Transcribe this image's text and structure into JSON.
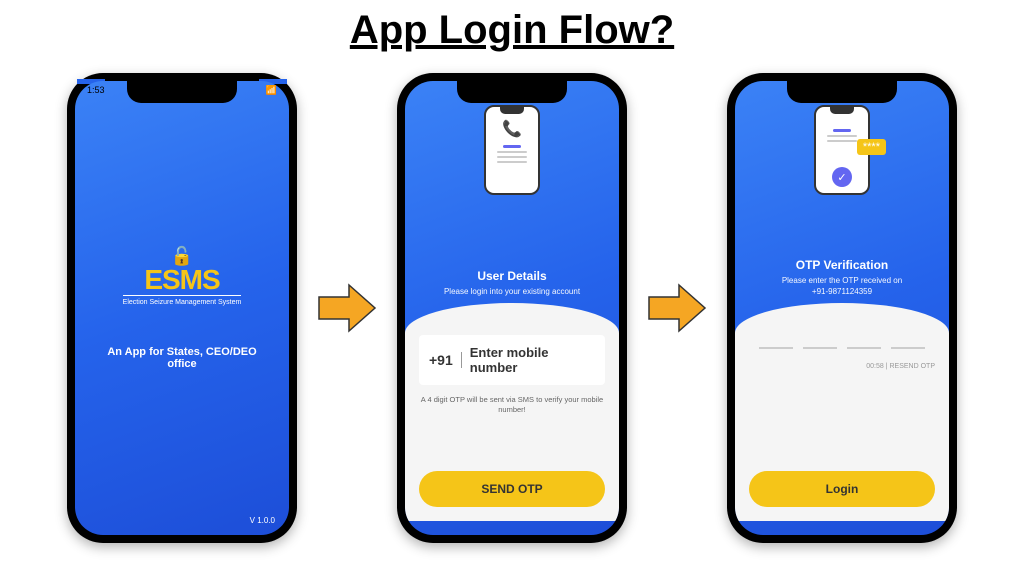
{
  "title": "App Login Flow?",
  "splash": {
    "time": "1:53",
    "logo": "ESMS",
    "logoSub": "Election Seizure\nManagement System",
    "tagline": "An App for States, CEO/DEO office",
    "version": "V 1.0.0"
  },
  "userDetails": {
    "title": "User Details",
    "subtitle": "Please login into your existing account",
    "prefix": "+91",
    "placeholder": "Enter mobile number",
    "hint": "A 4 digit OTP will be sent via SMS to verify your mobile number!",
    "button": "SEND OTP"
  },
  "otp": {
    "title": "OTP Verification",
    "subtitle": "Please enter the OTP received on",
    "phone": "+91-9871124359",
    "badge": "****",
    "resend": "00:58 | RESEND OTP",
    "button": "Login"
  }
}
